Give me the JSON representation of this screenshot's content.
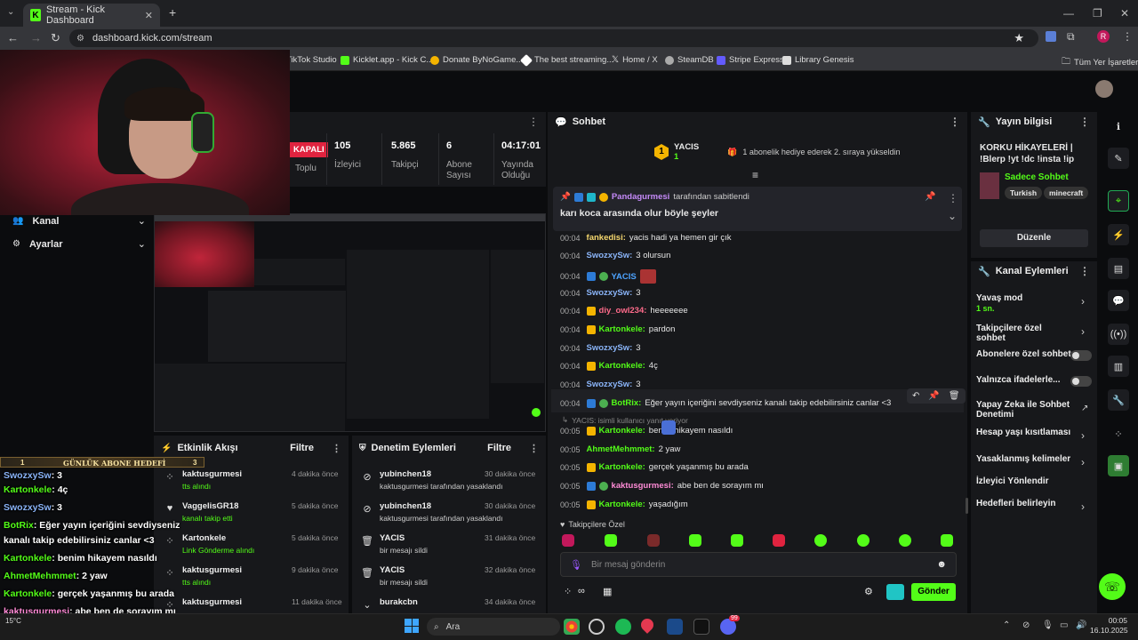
{
  "browser": {
    "tab_title": "Stream - Kick Dashboard",
    "url": "dashboard.kick.com/stream",
    "bookmarks": [
      "TikTok Studio",
      "Kicklet.app - Kick C...",
      "Donate ByNoGame...",
      "The best streaming...",
      "Home / X",
      "SteamDB",
      "Stripe Express",
      "Library Genesis"
    ],
    "other_bookmarks": "Tüm Yer İşaretleri",
    "profile_initial": "R"
  },
  "sidebar": {
    "items": [
      {
        "label": "Kanal",
        "icon": "people-icon"
      },
      {
        "label": "Ayarlar",
        "icon": "gear-icon"
      }
    ]
  },
  "stream_status": {
    "badge": "KAPALI",
    "stats": [
      {
        "value": "",
        "label": "Toplu"
      },
      {
        "value": "105",
        "label": "İzleyici"
      },
      {
        "value": "5.865",
        "label": "Takipçi"
      },
      {
        "value": "6",
        "label": "Abone Sayısı"
      },
      {
        "value": "04:17:01",
        "label": "Yayında Olduğu"
      }
    ]
  },
  "chat": {
    "title": "Sohbet",
    "goal_user": "YACIS",
    "goal_count": "1",
    "goal_text": "1 abonelik hediye ederek 2. sıraya yükseldin",
    "pinned": {
      "user": "Pandagurmesi",
      "suffix": "tarafından sabitlendi",
      "text": "karı koca arasında olur böyle şeyler"
    },
    "messages": [
      {
        "time": "00:04",
        "user": "fankedisi",
        "text": "yacis hadi ya hemen gir çık",
        "color": "#f5d76e"
      },
      {
        "time": "00:04",
        "user": "SwozxySw",
        "text": "3 olursun",
        "color": "#8ab4f8"
      },
      {
        "time": "00:04",
        "user": "YACIS",
        "text": "",
        "color": "#4da3ff"
      },
      {
        "time": "00:04",
        "user": "SwozxySw",
        "text": "3",
        "color": "#8ab4f8"
      },
      {
        "time": "00:04",
        "user": "diy_owl234",
        "text": "heeeeeee",
        "color": "#ff6b8b"
      },
      {
        "time": "00:04",
        "user": "Kartonkele",
        "text": "pardon",
        "color": "#53fc18"
      },
      {
        "time": "00:04",
        "user": "SwozxySw",
        "text": "3",
        "color": "#8ab4f8"
      },
      {
        "time": "00:04",
        "user": "Kartonkele",
        "text": "4ç",
        "color": "#53fc18"
      },
      {
        "time": "00:04",
        "user": "SwozxySw",
        "text": "3",
        "color": "#8ab4f8"
      },
      {
        "time": "00:04",
        "user": "BotRix",
        "text": "Eğer yayın içeriğini sevdiyseniz kanalı takip edebilirsiniz canlar <3",
        "color": "#53fc18"
      },
      {
        "time": "00:05",
        "user": "Kartonkele",
        "text": "benim hikayem nasıldı",
        "color": "#53fc18"
      },
      {
        "time": "00:05",
        "user": "AhmetMehmmet",
        "text": "2 yaw",
        "color": "#53fc18"
      },
      {
        "time": "00:05",
        "user": "Kartonkele",
        "text": "gerçek yaşanmış bu arada",
        "color": "#53fc18"
      },
      {
        "time": "00:05",
        "user": "kaktusgurmesi",
        "text": "abe ben de sorayım mı",
        "color": "#ff8bd6"
      },
      {
        "time": "00:05",
        "user": "Kartonkele",
        "text": "yaşadığım",
        "color": "#53fc18"
      }
    ],
    "reply_preview": "YACIS:  isimli kullanıcı yanıt veriyor",
    "followers_only": "Takipçilere Özel",
    "input_placeholder": "Bir mesaj gönderin",
    "send_label": "Gönder"
  },
  "stream_info": {
    "title": "Yayın bilgisi",
    "stream_title": "KORKU HİKAYELERİ | !Blerp !yt !dc !insta !ip",
    "category": "Sadece Sohbet",
    "tags": [
      "Turkish",
      "minecraft"
    ],
    "edit_label": "Düzenle"
  },
  "channel_actions": {
    "title": "Kanal Eylemleri",
    "items": [
      {
        "label": "Yavaş mod",
        "sub": "1 sn.",
        "kind": "chevron"
      },
      {
        "label": "Takipçilere özel sohbet",
        "kind": "chevron"
      },
      {
        "label": "Abonelere özel sohbet",
        "kind": "toggle"
      },
      {
        "label": "Yalnızca ifadelerle...",
        "kind": "toggle"
      },
      {
        "label": "Yapay Zeka ile Sohbet Denetimi",
        "kind": "external"
      },
      {
        "label": "Hesap yaşı kısıtlaması",
        "kind": "chevron"
      },
      {
        "label": "Yasaklanmış kelimeler",
        "kind": "chevron"
      },
      {
        "label": "İzleyici Yönlendir",
        "kind": "none"
      },
      {
        "label": "Hedefleri belirleyin",
        "kind": "chevron"
      }
    ]
  },
  "activity": {
    "title": "Etkinlik Akışı",
    "filter": "Filtre",
    "items": [
      {
        "user": "kaktusgurmesi",
        "action": "tts alındı",
        "time": "4 dakika önce"
      },
      {
        "user": "VaggelisGR18",
        "action": "kanalı takip etti",
        "time": "5 dakika önce"
      },
      {
        "user": "Kartonkele",
        "action": "Link Gönderme alındı",
        "time": "5 dakika önce"
      },
      {
        "user": "kaktusgurmesi",
        "action": "tts alındı",
        "time": "9 dakika önce"
      },
      {
        "user": "kaktusgurmesi",
        "action": "",
        "time": "11 dakika önce"
      }
    ]
  },
  "moderation": {
    "title": "Denetim Eylemleri",
    "filter": "Filtre",
    "items": [
      {
        "user": "yubinchen18",
        "action": "kaktusgurmesi tarafından yasaklandı",
        "time": "30 dakika önce"
      },
      {
        "user": "yubinchen18",
        "action": "kaktusgurmesi tarafından yasaklandı",
        "time": "30 dakika önce"
      },
      {
        "user": "YACIS",
        "action": "bir mesajı sildi",
        "time": "31 dakika önce"
      },
      {
        "user": "YACIS",
        "action": "bir mesajı sildi",
        "time": "32 dakika önce"
      },
      {
        "user": "burakcbn",
        "action": "",
        "time": "34 dakika önce"
      }
    ]
  },
  "overlay": {
    "goal_label": "GÜNLÜK ABONE HEDEFİ",
    "goal_current": "1",
    "goal_target": "3",
    "chat": [
      {
        "user": "SwozxySw",
        "text": ": 3",
        "color": "#8ab4f8"
      },
      {
        "user": "Kartonkele",
        "text": ": 4ç",
        "color": "#53fc18"
      },
      {
        "user": "SwozxySw",
        "text": ": 3",
        "color": "#8ab4f8"
      },
      {
        "user": "BotRix",
        "text": ": Eğer yayın içeriğini sevdiyseniz",
        "color": "#53fc18"
      },
      {
        "user": "",
        "text": "kanalı takip edebilirsiniz canlar <3",
        "color": "#fff"
      },
      {
        "user": "Kartonkele",
        "text": ": benim hikayem nasıldı",
        "color": "#53fc18"
      },
      {
        "user": "AhmetMehmmet",
        "text": ": 2 yaw",
        "color": "#53fc18"
      },
      {
        "user": "Kartonkele",
        "text": ": gerçek yaşanmış bu arada",
        "color": "#53fc18"
      },
      {
        "user": "kaktusgurmesi",
        "text": ": abe ben de sorayım mı",
        "color": "#ff8bd6"
      },
      {
        "user": "Kartonkele",
        "text": ": yaşadığım",
        "color": "#53fc18"
      }
    ]
  },
  "taskbar": {
    "search": "Ara",
    "weather": "15°C",
    "time": "00:05",
    "date": "16.10.2025",
    "discord_badge": "99"
  }
}
